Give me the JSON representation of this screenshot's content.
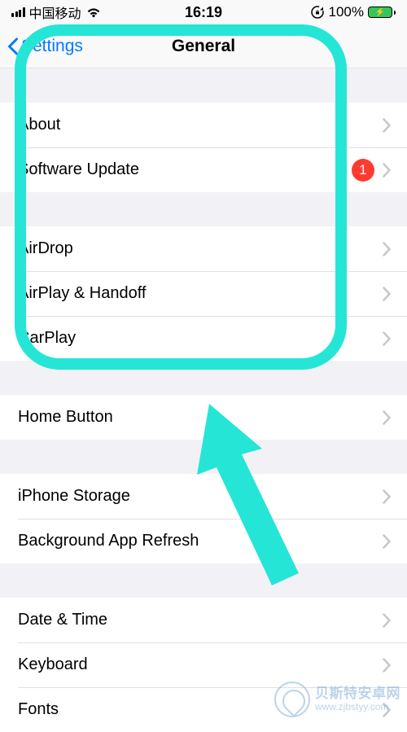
{
  "status": {
    "carrier": "中国移动",
    "time": "16:19",
    "battery_pct": "100%"
  },
  "nav": {
    "back_label": "Settings",
    "title": "General"
  },
  "sections": [
    {
      "rows": [
        {
          "label": "About",
          "badge": null
        },
        {
          "label": "Software Update",
          "badge": "1"
        }
      ]
    },
    {
      "rows": [
        {
          "label": "AirDrop",
          "badge": null
        },
        {
          "label": "AirPlay & Handoff",
          "badge": null
        },
        {
          "label": "CarPlay",
          "badge": null
        }
      ]
    },
    {
      "rows": [
        {
          "label": "Home Button",
          "badge": null
        }
      ]
    },
    {
      "rows": [
        {
          "label": "iPhone Storage",
          "badge": null
        },
        {
          "label": "Background App Refresh",
          "badge": null
        }
      ]
    },
    {
      "rows": [
        {
          "label": "Date & Time",
          "badge": null
        },
        {
          "label": "Keyboard",
          "badge": null
        },
        {
          "label": "Fonts",
          "badge": null
        }
      ]
    }
  ],
  "annotation": {
    "highlight_color": "#25e6d6",
    "arrow_color": "#25e6d6"
  },
  "watermark": {
    "main": "贝斯特安卓网",
    "sub": "www.zjbstyy.com"
  }
}
